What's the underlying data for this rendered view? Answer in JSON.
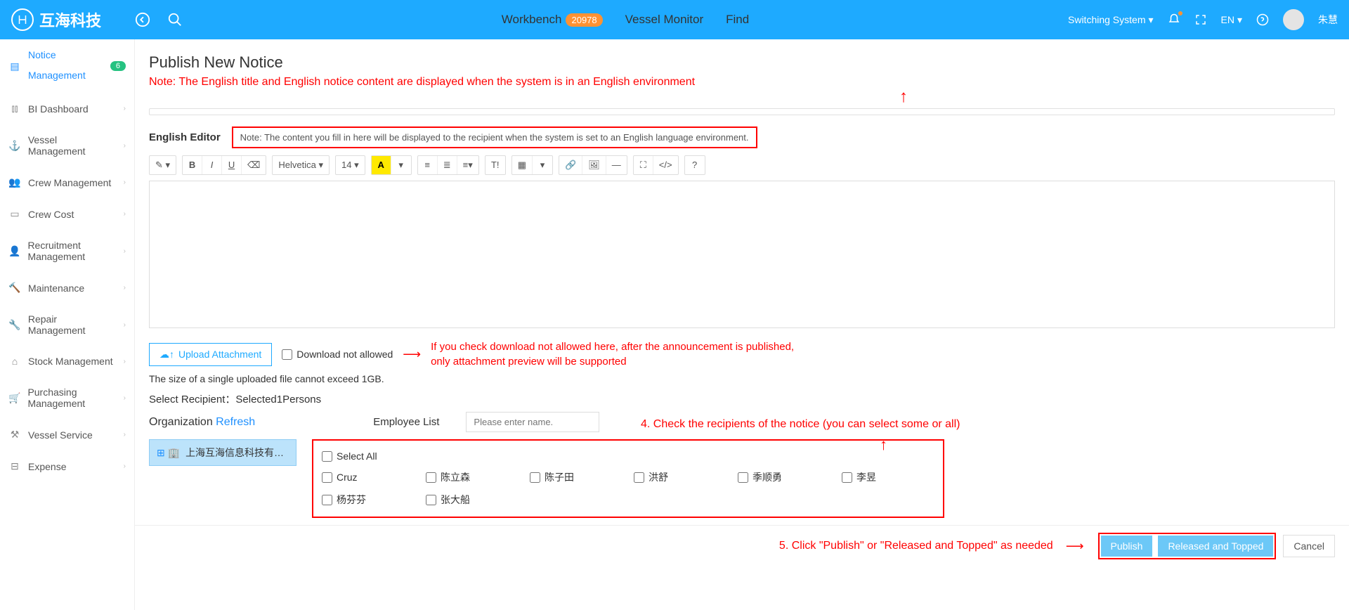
{
  "topbar": {
    "brand": "互海科技",
    "nav": {
      "workbench": "Workbench",
      "badge": "20978",
      "vessel_monitor": "Vessel Monitor",
      "find": "Find"
    },
    "right": {
      "switching": "Switching System",
      "lang": "EN",
      "user": "朱慧"
    }
  },
  "sidebar": {
    "notice": {
      "label": "Notice",
      "count": "6",
      "sub": "Management"
    },
    "items": [
      "BI Dashboard",
      "Vessel Management",
      "Crew Management",
      "Crew Cost",
      "Recruitment Management",
      "Maintenance",
      "Repair Management",
      "Stock Management",
      "Purchasing Management",
      "Vessel Service",
      "Expense"
    ]
  },
  "page": {
    "title": "Publish New Notice",
    "note_banner": "Note: The English title and English notice content are displayed when the system is in an English environment"
  },
  "editor": {
    "label": "English Editor",
    "note_box": "Note: The content you fill in here will be displayed to the recipient when the system is set to an English language environment.",
    "font_family": "Helvetica",
    "font_size": "14"
  },
  "upload": {
    "btn": "Upload Attachment",
    "chk_label": "Download not allowed",
    "note_red1": "If you check download not allowed here, after the announcement is published,",
    "note_red2": "only attachment preview will be supported",
    "size_note": "The size of a single uploaded file cannot exceed 1GB."
  },
  "recip": {
    "label": "Select Recipient：Selected1Persons",
    "org_label": "Organization",
    "refresh": "Refresh",
    "emp_label": "Employee List",
    "search_placeholder": "Please enter name.",
    "org_chip": "上海互海信息科技有…",
    "select_all": "Select All",
    "employees": [
      "Cruz",
      "陈立森",
      "陈子田",
      "洪舒",
      "季顺勇",
      "李昱",
      "杨芬芬",
      "张大船"
    ]
  },
  "ann": {
    "step4": "4. Check the recipients of the notice (you can select some or all)",
    "step5": "5. Click \"Publish\" or \"Released and Topped\" as needed"
  },
  "footer": {
    "publish": "Publish",
    "released": "Released and Topped",
    "cancel": "Cancel"
  }
}
